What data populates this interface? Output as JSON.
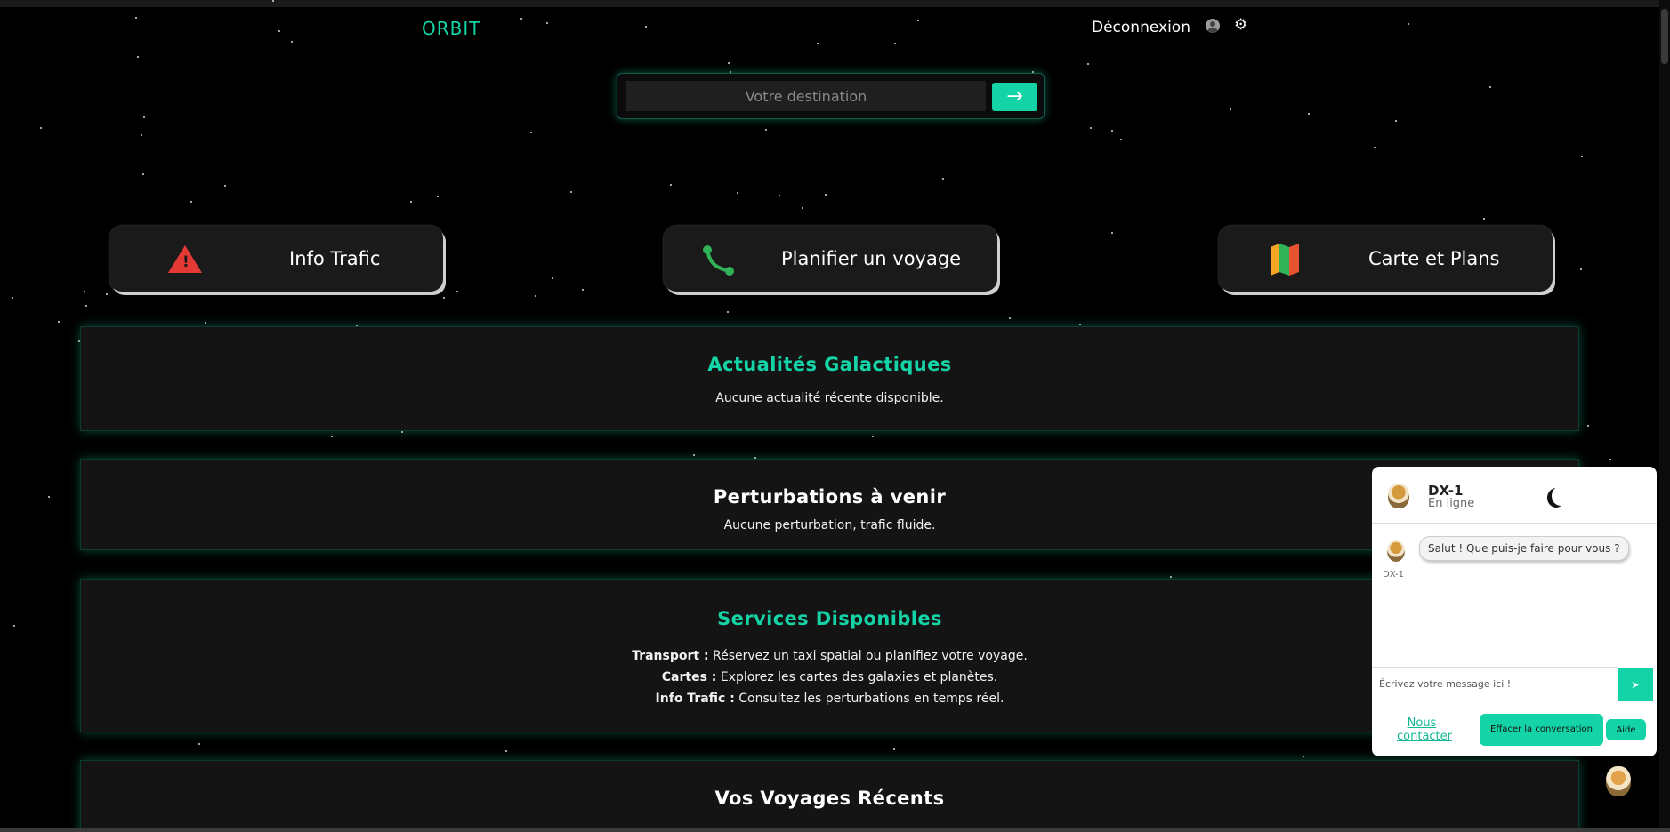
{
  "header": {
    "brand": "ORBIT",
    "logout_label": "Déconnexion"
  },
  "search": {
    "placeholder": "Votre destination",
    "button_glyph": "→"
  },
  "quick_links": [
    {
      "label": "Info Trafic",
      "icon": "warning-icon"
    },
    {
      "label": "Planifier un voyage",
      "icon": "route-icon"
    },
    {
      "label": "Carte et Plans",
      "icon": "map-icon"
    }
  ],
  "sections": {
    "news": {
      "title": "Actualités Galactiques",
      "text": "Aucune actualité récente disponible."
    },
    "disruptions": {
      "title": "Perturbations à venir",
      "text": "Aucune perturbation, trafic fluide."
    },
    "services": {
      "title": "Services Disponibles",
      "items": [
        {
          "name": "Transport :",
          "desc": "Réservez un taxi spatial ou planifiez votre voyage."
        },
        {
          "name": "Cartes :",
          "desc": "Explorez les cartes des galaxies et planètes."
        },
        {
          "name": "Info Trafic :",
          "desc": "Consultez les perturbations en temps réel."
        }
      ]
    },
    "recent_trips": {
      "title": "Vos Voyages Récents"
    }
  },
  "chat": {
    "bot_name": "DX-1",
    "status": "En ligne",
    "message": "Salut ! Que puis-je faire pour vous ?",
    "message_sender": "DX-1",
    "input_placeholder": "Écrivez votre message ici !",
    "send_glyph": "➤",
    "contact_label": "Nous contacter",
    "clear_label": "Effacer la conversation",
    "help_label": "Aide"
  },
  "colors": {
    "accent": "#14d3a6",
    "background": "#000000",
    "card": "#1a1a1a",
    "danger": "#e53935"
  }
}
